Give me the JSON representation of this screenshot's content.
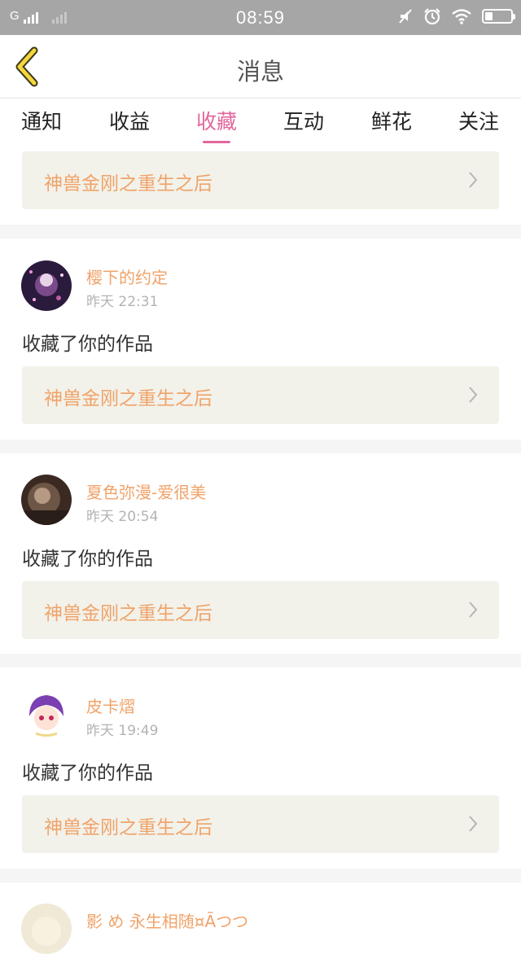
{
  "status_bar": {
    "network": "G",
    "time": "08:59",
    "battery_level": 0.3,
    "icons": [
      "signal-icon",
      "signal-dim-icon",
      "mute-icon",
      "alarm-icon",
      "wifi-icon",
      "battery-icon"
    ]
  },
  "header": {
    "title": "消息",
    "back_icon": "chevron-left-icon"
  },
  "tabs": [
    {
      "label": "通知"
    },
    {
      "label": "收益"
    },
    {
      "label": "收藏",
      "active": true
    },
    {
      "label": "互动"
    },
    {
      "label": "鲜花"
    },
    {
      "label": "关注"
    }
  ],
  "top_item": {
    "work_title": "神兽金刚之重生之后"
  },
  "items": [
    {
      "user": "樱下的约定",
      "time": "昨天 22:31",
      "action": "收藏了你的作品",
      "work_title": "神兽金刚之重生之后"
    },
    {
      "user": "夏色弥漫-爱很美",
      "time": "昨天 20:54",
      "action": "收藏了你的作品",
      "work_title": "神兽金刚之重生之后"
    },
    {
      "user": "皮卡熠",
      "time": "昨天 19:49",
      "action": "收藏了你的作品",
      "work_title": "神兽金刚之重生之后"
    },
    {
      "user": "影 め 永生相随¤Ãつつ"
    }
  ],
  "colors": {
    "accent_pink": "#e2679c",
    "name_orange": "#f0a36a",
    "card_bg": "#f2f2ea",
    "status_bar_bg": "#a6a6a6",
    "back_icon_yellow": "#f5d63d"
  }
}
